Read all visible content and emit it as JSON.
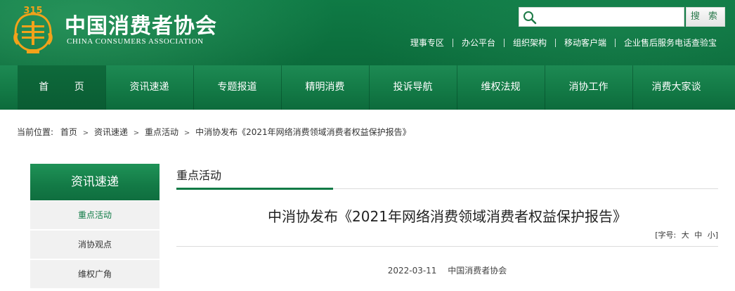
{
  "header": {
    "brand_cn": "中国消费者协会",
    "brand_en": "CHINA CONSUMERS ASSOCIATION",
    "logo_mark": "315",
    "search": {
      "placeholder": "",
      "button_label": "搜 索"
    },
    "top_links": [
      "理事专区",
      "办公平台",
      "组织架构",
      "移动客户端",
      "企业售后服务电话查验宝"
    ]
  },
  "nav": {
    "items": [
      "首 页",
      "资讯速递",
      "专题报道",
      "精明消费",
      "投诉导航",
      "维权法规",
      "消协工作",
      "消费大家谈"
    ]
  },
  "breadcrumb": {
    "prefix": "当前位置:",
    "items": [
      "首页",
      "资讯速递",
      "重点活动",
      "中消协发布《2021年网络消费领域消费者权益保护报告》"
    ]
  },
  "sidebar": {
    "title": "资讯速递",
    "items": [
      "重点活动",
      "消协观点",
      "维权广角"
    ]
  },
  "main": {
    "section_title": "重点活动",
    "article_title": "中消协发布《2021年网络消费领域消费者权益保护报告》",
    "font_size": {
      "label": "[字号:",
      "options": [
        "大",
        "中",
        "小"
      ],
      "close": "]"
    },
    "date": "2022-03-11",
    "source": "中国消费者协会"
  },
  "colors": {
    "brand_green": "#0f7a45",
    "sidebar_bg": "#f1f1f1"
  }
}
